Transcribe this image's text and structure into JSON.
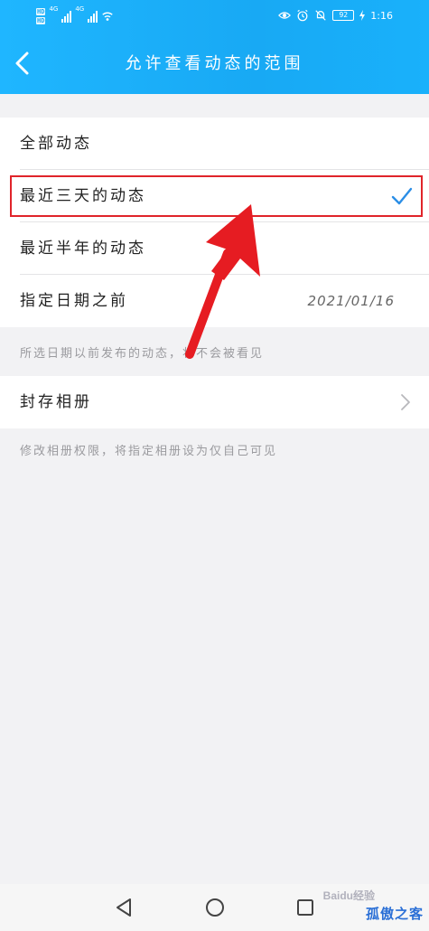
{
  "status_bar": {
    "left_tags": [
      "HD",
      "HD"
    ],
    "network_a": "4G",
    "network_b": "4G",
    "battery": "92",
    "time": "1:16"
  },
  "header": {
    "title": "允许查看动态的范围"
  },
  "options": [
    {
      "label": "全部动态",
      "selected": false
    },
    {
      "label": "最近三天的动态",
      "selected": true
    },
    {
      "label": "最近半年的动态",
      "selected": false
    },
    {
      "label": "指定日期之前",
      "value": "2021/01/16",
      "selected": false
    }
  ],
  "hints": {
    "date_hint": "所选日期以前发布的动态，将不会被看见",
    "album_hint": "修改相册权限，将指定相册设为仅自己可见"
  },
  "album": {
    "label": "封存相册"
  },
  "colors": {
    "header": "#1fb6ff",
    "check": "#2b8ee6",
    "highlight": "#e0242a"
  },
  "watermark": {
    "baidu": "Baidu经验",
    "site": "孤傲之客"
  }
}
